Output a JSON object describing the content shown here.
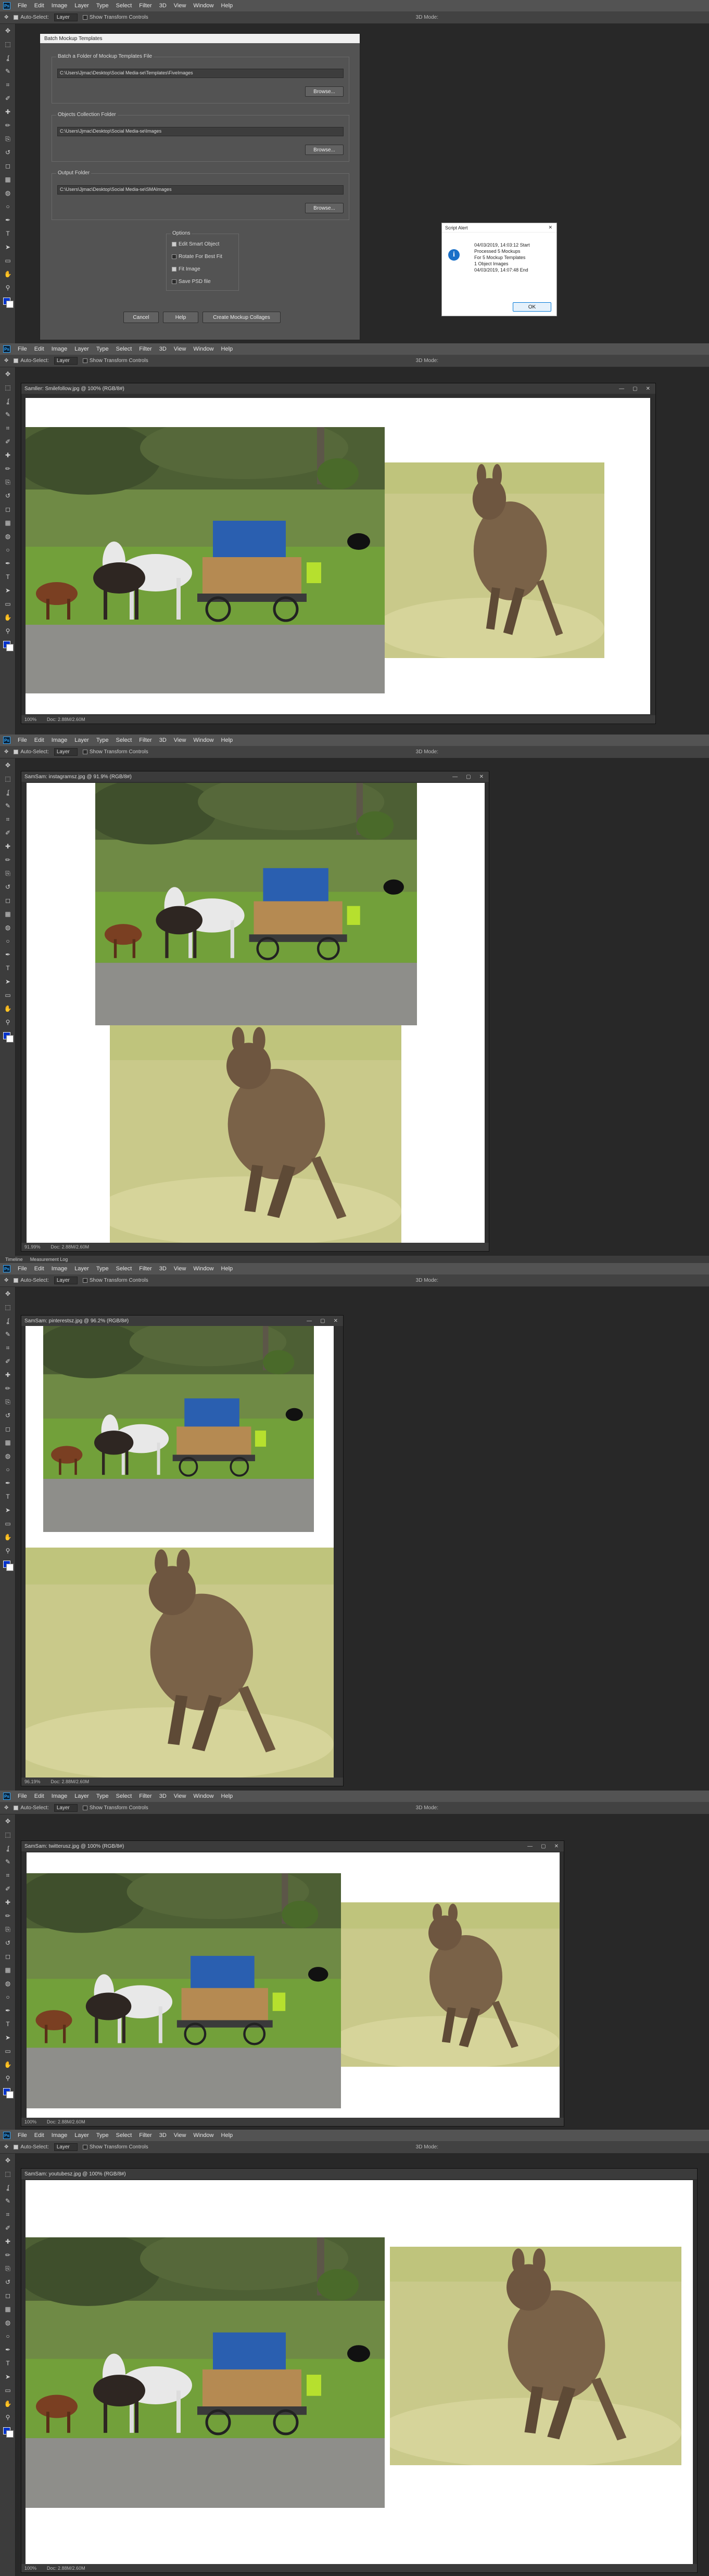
{
  "menu": [
    "File",
    "Edit",
    "Image",
    "Layer",
    "Type",
    "Select",
    "Filter",
    "3D",
    "View",
    "Window",
    "Help"
  ],
  "options": {
    "auto_select": "Auto-Select:",
    "layer": "Layer",
    "transform": "Show Transform Controls",
    "mode": "3D Mode:"
  },
  "dialog": {
    "title": "Batch Mockup Templates",
    "template_label": "Batch a Folder of Mockup Templates File",
    "template_path": "C:\\Users\\Jjmac\\Desktop\\Social Media-se\\Templates\\FiveImages",
    "objects_label": "Objects Collection Folder",
    "objects_path": "C:\\Users\\Jjmac\\Desktop\\Social Media-se\\Images",
    "output_label": "Output Folder",
    "output_path": "C:\\Users\\Jjmac\\Desktop\\Social Media-se\\SMAImages",
    "browse": "Browse...",
    "options_label": "Options",
    "opt1": "Edit Smart Object",
    "opt2": "Rotate For Best Fit",
    "opt3": "Fit Image",
    "opt4": "Save PSD file",
    "cancel": "Cancel",
    "help": "Help",
    "create": "Create Mockup Collages"
  },
  "alert": {
    "title": "Script Alert",
    "message": [
      "04/03/2019, 14:03:12 Start",
      "Processed 5 Mockups",
      "For 5 Mockup Templates",
      "1 Object Images",
      "04/03/2019, 14:07:48 End"
    ],
    "ok": "OK"
  },
  "windows": [
    {
      "tab": "Samller: Smilefollow.jpg @ 100% (RGB/8#)",
      "status": "100%",
      "doc": "Doc: 2.88M/2.60M"
    },
    {
      "tab": "SamSam: instagramsz.jpg @ 91.9% (RGB/8#)",
      "status": "91.99%",
      "doc": "Doc: 2.88M/2.60M"
    },
    {
      "tab": "SamSam: pinterestsz.jpg @ 96.2% (RGB/8#)",
      "status": "96.19%",
      "doc": "Doc: 2.88M/2.60M"
    },
    {
      "tab": "SamSam: twitterusz.jpg @ 100% (RGB/8#)",
      "status": "100%",
      "doc": "Doc: 2.88M/2.60M"
    },
    {
      "tab": "SamSam: youtubesz.jpg @ 100% (RGB/8#)",
      "status": "100%",
      "doc": "Doc: 2.88M/2.60M"
    }
  ],
  "panel_tabs": [
    "Timeline",
    "Measurement Log"
  ],
  "tools": [
    "move-tool-icon",
    "marquee-tool-icon",
    "lasso-tool-icon",
    "quick-select-tool-icon",
    "crop-tool-icon",
    "eyedropper-tool-icon",
    "healing-brush-tool-icon",
    "brush-tool-icon",
    "clone-stamp-tool-icon",
    "history-brush-tool-icon",
    "eraser-tool-icon",
    "gradient-tool-icon",
    "blur-tool-icon",
    "dodge-tool-icon",
    "pen-tool-icon",
    "type-tool-icon",
    "path-select-tool-icon",
    "rectangle-tool-icon",
    "hand-tool-icon",
    "zoom-tool-icon"
  ],
  "tool_glyphs": [
    "✥",
    "⬚",
    "ʆ",
    "✎",
    "⌗",
    "✐",
    "✚",
    "✏",
    "⎘",
    "↺",
    "◻",
    "▦",
    "◍",
    "○",
    "✒",
    "T",
    "➤",
    "▭",
    "✋",
    "⚲"
  ]
}
